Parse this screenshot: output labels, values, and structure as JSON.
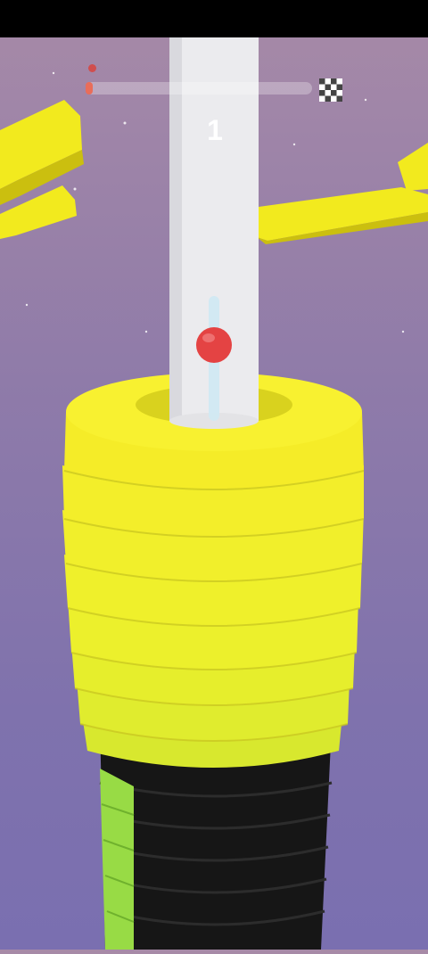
{
  "hud": {
    "score": "1",
    "progress": 0.03,
    "finish_icon": "checkered-flag-icon"
  },
  "colors": {
    "background_top": "#a78aa7",
    "background_bottom": "#7a6fb0",
    "ring_yellow": "#f0ee2c",
    "ring_black": "#1a1a1a",
    "ring_green": "#9de04a",
    "pole": "#e9e9ec",
    "ball": "#e44343",
    "progress_fill": "#e96d5a"
  }
}
